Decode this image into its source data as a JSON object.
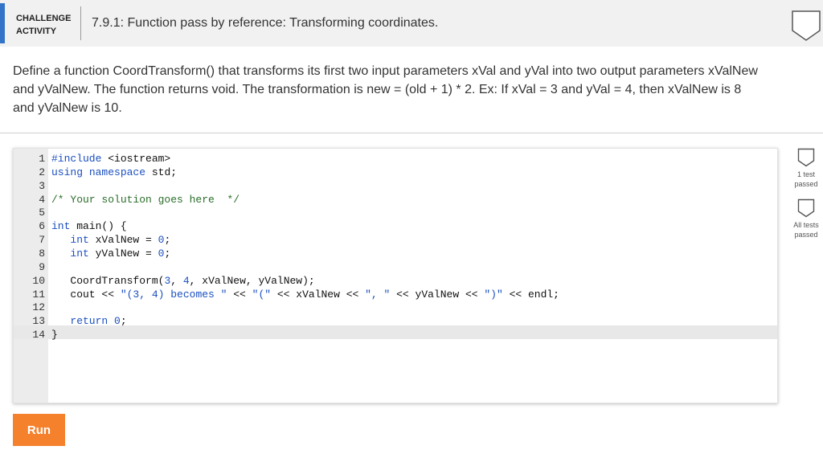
{
  "header": {
    "badge_line1": "CHALLENGE",
    "badge_line2": "ACTIVITY",
    "title": "7.9.1: Function pass by reference: Transforming coordinates.",
    "status_icon": "shield-outline-icon"
  },
  "description": "Define a function CoordTransform() that transforms its first two input parameters xVal and yVal into two output parameters xValNew and yValNew. The function returns void. The transformation is new = (old + 1) * 2. Ex: If xVal = 3 and yVal = 4, then xValNew is 8 and yValNew is 10.",
  "editor": {
    "lines": [
      {
        "num": "1",
        "code": "#include <iostream>"
      },
      {
        "num": "2",
        "code": "using namespace std;"
      },
      {
        "num": "3",
        "code": ""
      },
      {
        "num": "4",
        "code": "/* Your solution goes here  */"
      },
      {
        "num": "5",
        "code": ""
      },
      {
        "num": "6",
        "code": "int main() {"
      },
      {
        "num": "7",
        "code": "   int xValNew = 0;"
      },
      {
        "num": "8",
        "code": "   int yValNew = 0;"
      },
      {
        "num": "9",
        "code": ""
      },
      {
        "num": "10",
        "code": "   CoordTransform(3, 4, xValNew, yValNew);"
      },
      {
        "num": "11",
        "code": "   cout << \"(3, 4) becomes \" << \"(\" << xValNew << \", \" << yValNew << \")\" << endl;"
      },
      {
        "num": "12",
        "code": ""
      },
      {
        "num": "13",
        "code": "   return 0;"
      },
      {
        "num": "14",
        "code": "}"
      }
    ],
    "active_line": "14"
  },
  "tests": [
    {
      "label": "1 test passed",
      "icon": "shield-outline-icon"
    },
    {
      "label": "All tests passed",
      "icon": "shield-outline-icon"
    }
  ],
  "run_button": "Run",
  "colors": {
    "accent": "#3174c8",
    "run": "#f5812d",
    "keyword": "#1a4fbf",
    "comment": "#2b6e2b"
  }
}
